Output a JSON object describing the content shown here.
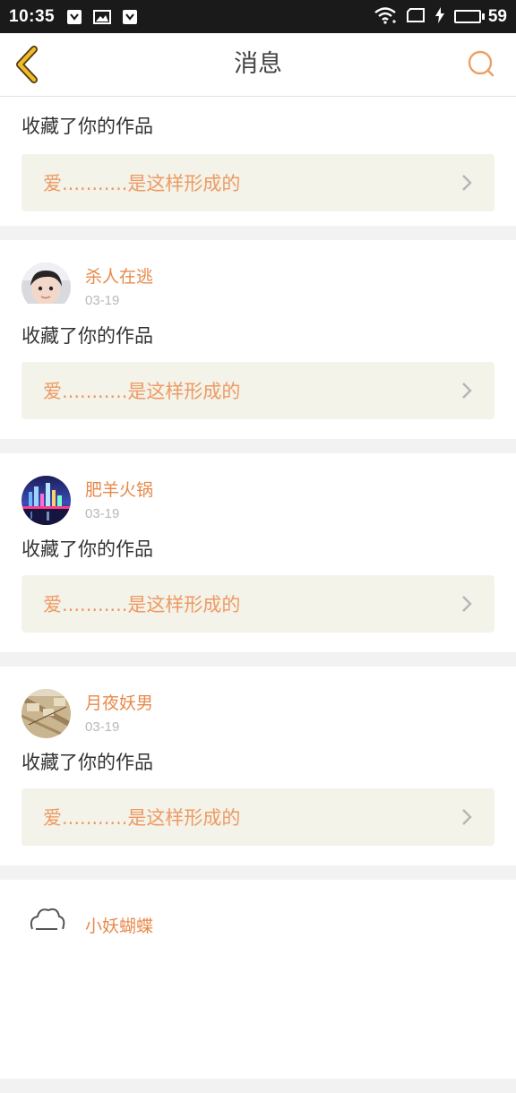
{
  "status_bar": {
    "time": "10:35",
    "battery_percent": "59",
    "battery_level": 0.59,
    "left_icons": [
      "shield-icon",
      "image-icon",
      "shield-icon"
    ],
    "right_icons": [
      "wifi-icon",
      "screen-rotate-icon",
      "charging-icon"
    ]
  },
  "nav": {
    "title": "消息",
    "back_icon": "chevron-left-icon",
    "search_icon": "search-icon"
  },
  "colors": {
    "accent": "#e8894b",
    "back_arrow": "#f2b92a",
    "link_bg": "#f3f3ea",
    "link_text": "#ee9a62"
  },
  "messages": [
    {
      "action": "收藏了你的作品",
      "work_title": "爱...........是这样形成的"
    },
    {
      "user": "杀人在逃",
      "date": "03-19",
      "avatar": "child-photo",
      "action": "收藏了你的作品",
      "work_title": "爱...........是这样形成的"
    },
    {
      "user": "肥羊火锅",
      "date": "03-19",
      "avatar": "city-night-photo",
      "action": "收藏了你的作品",
      "work_title": "爱...........是这样形成的"
    },
    {
      "user": "月夜妖男",
      "date": "03-19",
      "avatar": "map-photo",
      "action": "收藏了你的作品",
      "work_title": "爱...........是这样形成的"
    },
    {
      "user": "小妖蝴蝶",
      "avatar": "cloud-sketch"
    }
  ]
}
